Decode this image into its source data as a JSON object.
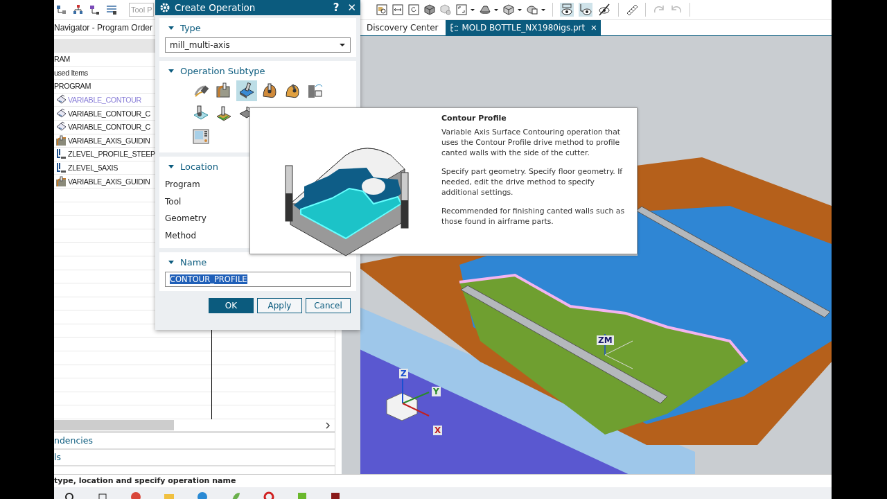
{
  "toolbar": {
    "search_placeholder": "Tool P"
  },
  "navigator": {
    "title": "Navigator - Program Order",
    "tree": [
      {
        "label": "RAM",
        "highlighted": false,
        "children": [
          {
            "label": "used Items",
            "highlighted": false
          },
          {
            "label": "PROGRAM",
            "highlighted": false,
            "children": [
              {
                "label": "VARIABLE_CONTOUR",
                "kind": "contour",
                "highlighted": true
              },
              {
                "label": "VARIABLE_CONTOUR_C",
                "kind": "contour",
                "highlighted": false
              },
              {
                "label": "VARIABLE_CONTOUR_C",
                "kind": "contour",
                "highlighted": false
              },
              {
                "label": "VARIABLE_AXIS_GUIDIN",
                "kind": "guiding",
                "highlighted": false
              },
              {
                "label": "ZLEVEL_PROFILE_STEEP",
                "kind": "zlevel",
                "highlighted": false
              },
              {
                "label": "ZLEVEL_5AXIS",
                "kind": "zlevel",
                "highlighted": false
              },
              {
                "label": "VARIABLE_AXIS_GUIDIN",
                "kind": "guiding",
                "highlighted": false
              }
            ]
          }
        ]
      }
    ],
    "panels": [
      "ndencies",
      "ls"
    ]
  },
  "tabs": [
    {
      "label": "Discovery Center",
      "selected": false
    },
    {
      "label": "MOLD BOTTLE_NX1980igs.prt",
      "selected": true,
      "close": "✕"
    }
  ],
  "dialog": {
    "title": "Create Operation",
    "help": "?",
    "close": "✕",
    "type_section": {
      "title": "Type",
      "expanded": true,
      "value": "mill_multi-axis"
    },
    "subtype_section": {
      "title": "Operation Subtype",
      "expanded": true,
      "rows": [
        [
          {
            "kind": "flow",
            "selected": false
          },
          {
            "kind": "wall",
            "selected": false
          },
          {
            "kind": "profile",
            "selected": true
          },
          {
            "kind": "orange",
            "selected": false
          },
          {
            "kind": "orange2",
            "selected": false
          },
          {
            "kind": "guide",
            "selected": false
          }
        ],
        [
          {
            "kind": "surface",
            "selected": false
          },
          {
            "kind": "floor",
            "selected": false
          },
          {
            "kind": "corner",
            "selected": false
          }
        ],
        [
          {
            "kind": "screen",
            "selected": false
          }
        ]
      ]
    },
    "location_section": {
      "title": "Location",
      "expanded": true,
      "labels": [
        "Program",
        "Tool",
        "Geometry",
        "Method"
      ]
    },
    "name_section": {
      "title": "Name",
      "expanded": true,
      "value": "CONTOUR_PROFILE"
    },
    "buttons": [
      {
        "label": "OK",
        "kind": "primary"
      },
      {
        "label": "Apply",
        "kind": "secondary"
      },
      {
        "label": "Cancel",
        "kind": "secondary"
      }
    ]
  },
  "tooltip": {
    "title": "Contour Profile",
    "paragraphs": [
      "Variable Axis Surface Contouring operation that uses the Contour Profile drive method to profile canted walls with the side of the cutter.",
      "Specify part geometry. Specify floor geometry. If needed, edit the drive method to specify additional settings.",
      "Recommended for finishing canted walls such as those found in airframe parts."
    ]
  },
  "viewport": {
    "labels": [
      {
        "text": "ZM",
        "kind": "work"
      },
      {
        "text": "Z",
        "kind": "z"
      },
      {
        "text": "Y",
        "kind": "y"
      },
      {
        "text": "X",
        "kind": "x"
      }
    ]
  },
  "status_bar": {
    "text": "type, location and specify operation name"
  }
}
